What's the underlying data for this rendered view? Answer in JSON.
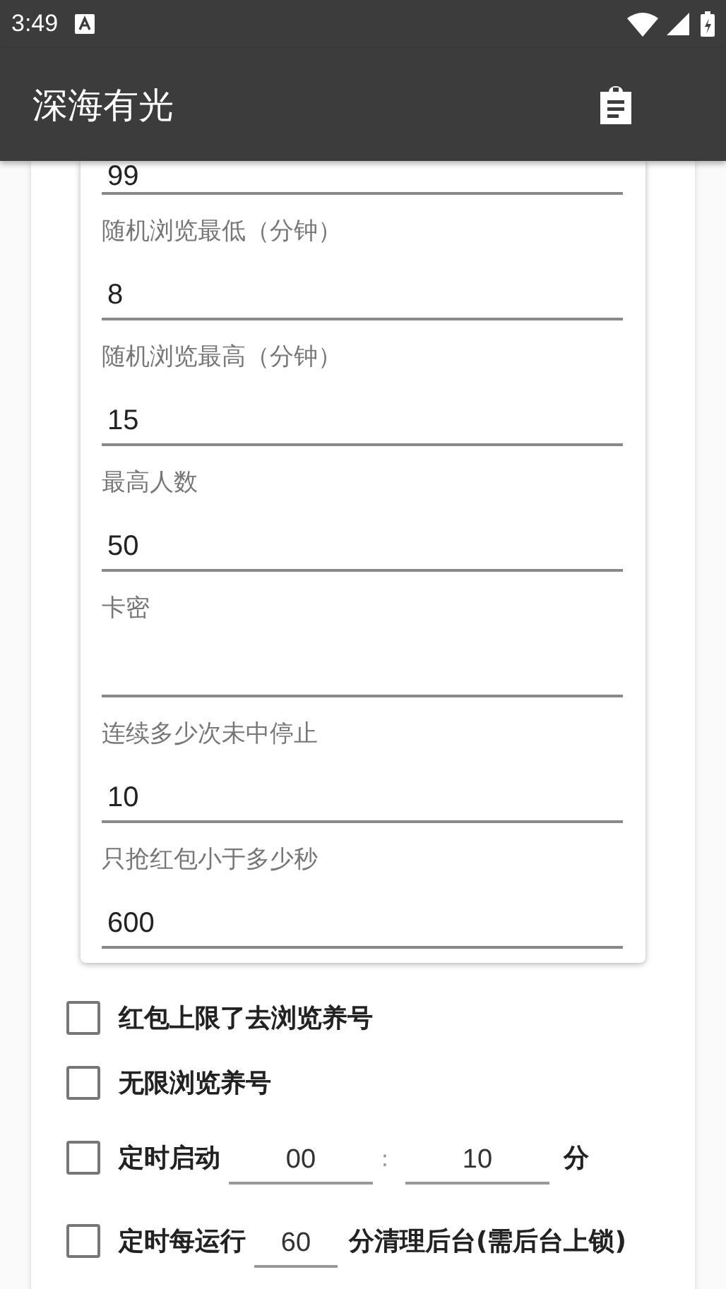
{
  "status_bar": {
    "time": "3:49"
  },
  "app_bar": {
    "title": "深海有光"
  },
  "fields": [
    {
      "value": "99"
    },
    {
      "label": "随机浏览最低（分钟）",
      "value": "8"
    },
    {
      "label": "随机浏览最高（分钟）",
      "value": "15"
    },
    {
      "label": "最高人数",
      "value": "50"
    },
    {
      "label": "卡密"
    },
    {
      "label": "连续多少次未中停止",
      "value": "10"
    },
    {
      "label": "只抢红包小于多少秒",
      "value": "600"
    }
  ],
  "options": [
    {
      "kind": "plain",
      "label": "红包上限了去浏览养号",
      "checked": false
    },
    {
      "kind": "plain",
      "label": "无限浏览养号",
      "checked": false
    },
    {
      "kind": "time",
      "label": "定时启动",
      "hour": "00",
      "separator": ":",
      "minute": "10",
      "unit": "分",
      "checked": false
    },
    {
      "kind": "interval",
      "label": "定时每运行",
      "value": "60",
      "suffix": "分清理后台(需后台上锁)",
      "checked": false
    }
  ]
}
